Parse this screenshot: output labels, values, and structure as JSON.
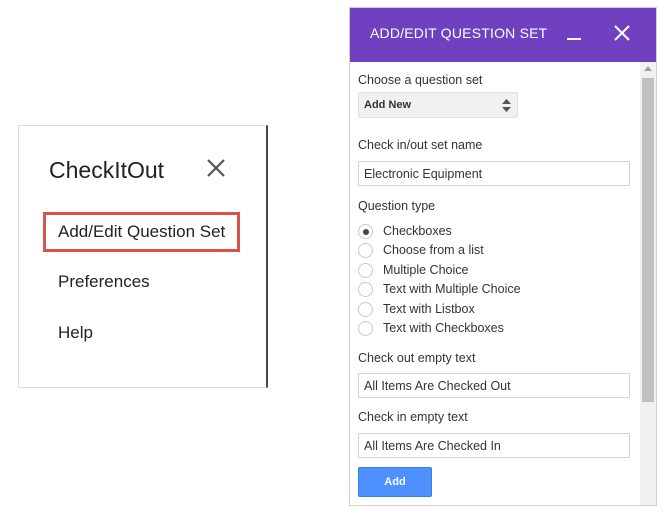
{
  "menu": {
    "title": "CheckItOut",
    "items": [
      {
        "label": "Add/Edit Question Set",
        "highlighted": true
      },
      {
        "label": "Preferences",
        "highlighted": false
      },
      {
        "label": "Help",
        "highlighted": false
      }
    ],
    "close_icon": "close-icon",
    "highlight_color": "#d9534f"
  },
  "dialog": {
    "title": "ADD/EDIT QUESTION SET",
    "header_color": "#7040c0",
    "minimize_icon": "minimize-icon",
    "close_icon": "close-icon",
    "question_set": {
      "label": "Choose a question set",
      "selected": "Add New"
    },
    "set_name": {
      "label": "Check in/out set name",
      "value": "Electronic Equipment"
    },
    "question_type": {
      "label": "Question type",
      "options": [
        {
          "label": "Checkboxes",
          "checked": true
        },
        {
          "label": "Choose from a list",
          "checked": false
        },
        {
          "label": "Multiple Choice",
          "checked": false
        },
        {
          "label": "Text with Multiple Choice",
          "checked": false
        },
        {
          "label": "Text with Listbox",
          "checked": false
        },
        {
          "label": "Text with Checkboxes",
          "checked": false
        }
      ]
    },
    "check_out_empty": {
      "label": "Check out empty text",
      "value": "All Items Are Checked Out"
    },
    "check_in_empty": {
      "label": "Check in empty text",
      "value": "All Items Are Checked In"
    },
    "add_button_label": "Add",
    "button_color": "#4d90fe"
  }
}
